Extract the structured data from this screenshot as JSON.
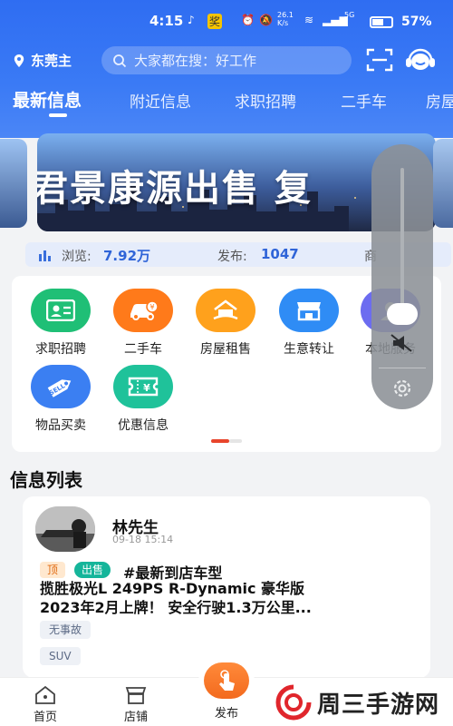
{
  "status_bar": {
    "time": "4:15",
    "net_speed": "26.1 K/s",
    "signal": "5G",
    "battery": "57%"
  },
  "header": {
    "location": "东莞主",
    "search_placeholder": "大家都在搜：好工作"
  },
  "tabs": [
    {
      "label": "最新信息",
      "active": true
    },
    {
      "label": "附近信息",
      "active": false
    },
    {
      "label": "求职招聘",
      "active": false
    },
    {
      "label": "二手车",
      "active": false
    },
    {
      "label": "房屋",
      "active": false
    }
  ],
  "banner": {
    "text": "君景康源出售 复"
  },
  "stats": {
    "views_label": "浏览:",
    "views_value": "7.92万",
    "posts_label": "发布:",
    "posts_value": "1047",
    "merchants_label": "商"
  },
  "categories": [
    {
      "label": "求职招聘",
      "color": "#1fbf76",
      "icon": "id-card-icon"
    },
    {
      "label": "二手车",
      "color": "#ff7a1a",
      "icon": "car-icon"
    },
    {
      "label": "房屋租售",
      "color": "#ffa11c",
      "icon": "house-icon"
    },
    {
      "label": "生意转让",
      "color": "#2f8cf5",
      "icon": "shop-icon"
    },
    {
      "label": "本地服务",
      "color": "#6c6cf0",
      "icon": "service-icon"
    },
    {
      "label": "物品买卖",
      "color": "#3b7ff2",
      "icon": "tag-icon"
    },
    {
      "label": "优惠信息",
      "color": "#1fc29a",
      "icon": "coupon-icon"
    }
  ],
  "section_title": "信息列表",
  "post": {
    "user": "林先生",
    "date": "09-18 15:14",
    "tag_top": "顶",
    "tag_sale": "出售",
    "hashtag": "#最新到店车型",
    "text_line1": "揽胜极光L 249PS R-Dynamic 豪华版",
    "text_line2": "2023年2月上牌！ 安全行驶1.3万公里...",
    "chips": [
      "无事故",
      "SUV"
    ]
  },
  "bottom_nav": {
    "home": "首页",
    "shop": "店铺",
    "publish": "发布"
  },
  "watermark": "周三手游网"
}
